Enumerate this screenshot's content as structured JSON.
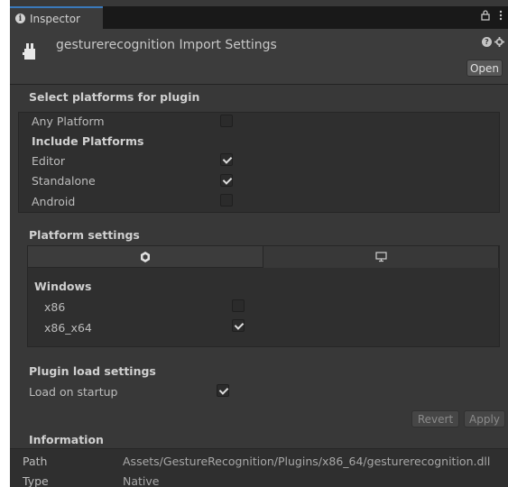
{
  "tab": {
    "label": "Inspector",
    "icon": "info-icon"
  },
  "tab_tools": {
    "lock_icon": "lock-icon",
    "menu_icon": "kebab-menu-icon"
  },
  "header": {
    "title": "gesturerecognition Import Settings",
    "open_label": "Open",
    "icon": "plugin-icon"
  },
  "select_platforms": {
    "title": "Select platforms for plugin",
    "any_platform": {
      "label": "Any Platform",
      "checked": false
    },
    "include_label": "Include Platforms",
    "editor": {
      "label": "Editor",
      "checked": true
    },
    "standalone": {
      "label": "Standalone",
      "checked": true
    },
    "android": {
      "label": "Android",
      "checked": false
    }
  },
  "platform_settings": {
    "title": "Platform settings",
    "tabs": [
      {
        "name": "unity-tab",
        "icon": "unity-logo-icon"
      },
      {
        "name": "desktop-tab",
        "icon": "monitor-icon"
      }
    ],
    "windows_label": "Windows",
    "x86": {
      "label": "x86",
      "checked": false
    },
    "x86_64": {
      "label": "x86_x64",
      "checked": true
    }
  },
  "plugin_load": {
    "title": "Plugin load settings",
    "load_on_startup": {
      "label": "Load on startup",
      "checked": true
    }
  },
  "buttons": {
    "revert": "Revert",
    "apply": "Apply"
  },
  "information": {
    "title": "Information",
    "path_label": "Path",
    "path_value": "Assets/GestureRecognition/Plugins/x86_64/gesturerecognition.dll",
    "type_label": "Type",
    "type_value": "Native"
  }
}
